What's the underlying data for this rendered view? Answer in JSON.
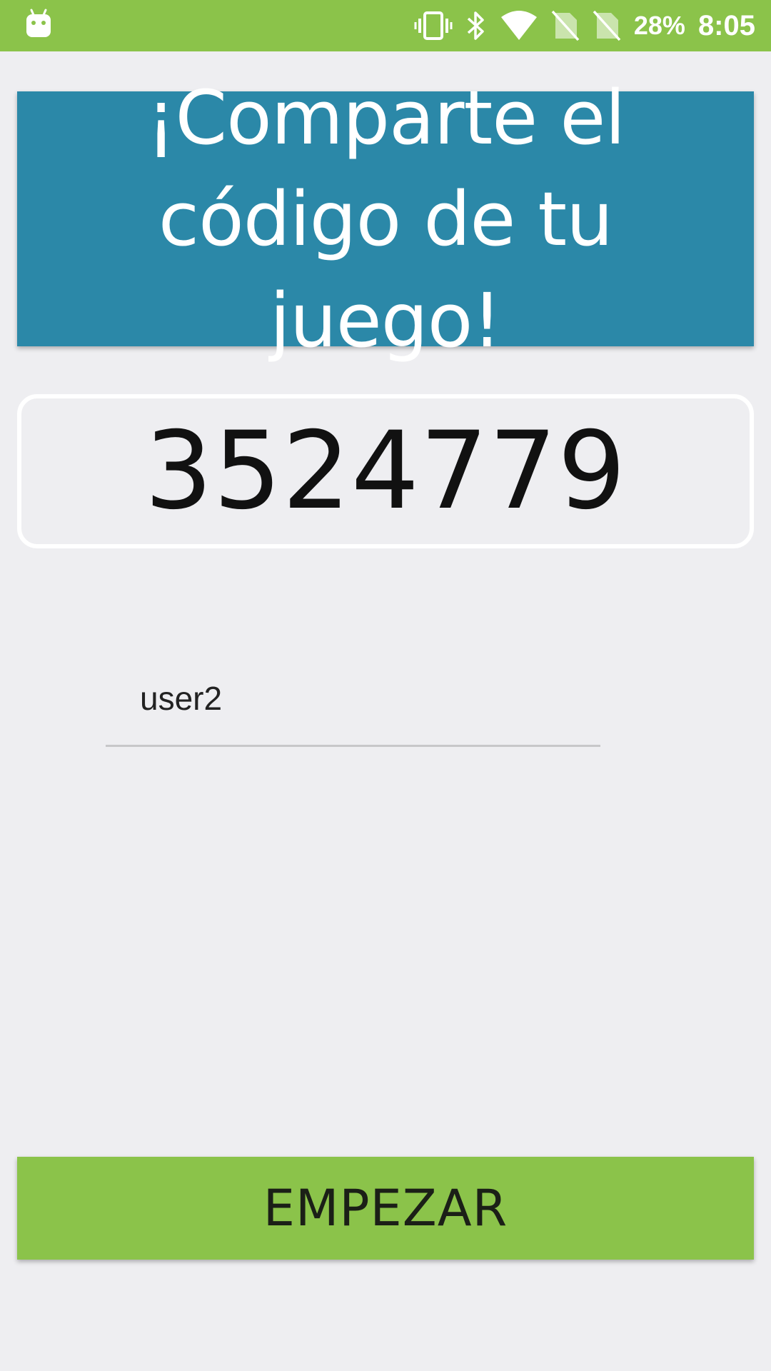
{
  "status_bar": {
    "battery_percent": "28%",
    "time": "8:05",
    "icons": [
      "android-icon",
      "vibrate-icon",
      "bluetooth-icon",
      "wifi-icon",
      "no-sim-icon",
      "no-sim-icon"
    ]
  },
  "header": {
    "title_line1": "¡Comparte el",
    "title_line2": "código de tu juego!"
  },
  "game_code": {
    "value": "3524779"
  },
  "name_input": {
    "value": "user2"
  },
  "start_button": {
    "label": "EMPEZAR"
  },
  "colors": {
    "status_bar": "#8bc34a",
    "header_bg": "#2b88a8",
    "background": "#eeeef1",
    "button_bg": "#8bc34a",
    "code_border": "#ffffff"
  }
}
